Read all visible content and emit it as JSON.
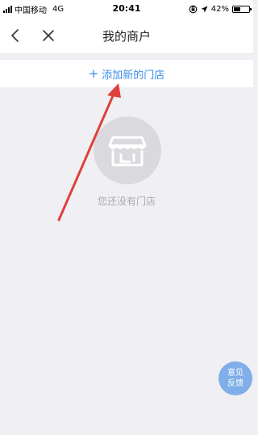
{
  "status_bar": {
    "carrier": "中国移动",
    "network": "4G",
    "time": "20:41",
    "battery_percent": "42%",
    "battery_level": 0.42
  },
  "nav": {
    "title": "我的商户",
    "back_icon": "chevron-left-icon",
    "close_icon": "close-icon"
  },
  "add_store": {
    "plus": "+",
    "label": "添加新的门店",
    "color": "#3a8ee6"
  },
  "empty_state": {
    "icon": "storefront-icon",
    "message": "您还没有门店"
  },
  "feedback": {
    "line1": "意见",
    "line2": "反馈",
    "color": "#7faee8"
  },
  "annotation": {
    "arrow_color": "#e0403a"
  }
}
